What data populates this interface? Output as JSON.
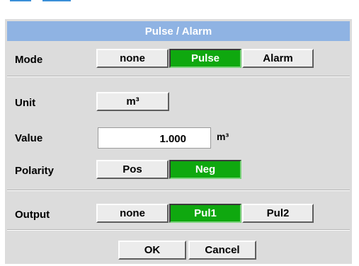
{
  "dialog": {
    "title": "Pulse / Alarm",
    "mode": {
      "label": "Mode",
      "options": [
        "none",
        "Pulse",
        "Alarm"
      ],
      "selected": "Pulse"
    },
    "unit": {
      "label": "Unit",
      "button_label": "m³"
    },
    "value": {
      "label": "Value",
      "input_value": "1.000",
      "unit": "m³"
    },
    "polarity": {
      "label": "Polarity",
      "options": [
        "Pos",
        "Neg"
      ],
      "selected": "Neg"
    },
    "output": {
      "label": "Output",
      "options": [
        "none",
        "Pul1",
        "Pul2"
      ],
      "selected": "Pul1"
    },
    "actions": {
      "ok_label": "OK",
      "cancel_label": "Cancel"
    }
  },
  "colors": {
    "title_bar": "#8fb3e3",
    "panel": "#dcdcdc",
    "active_button": "#0fa80f",
    "button": "#ececec"
  }
}
